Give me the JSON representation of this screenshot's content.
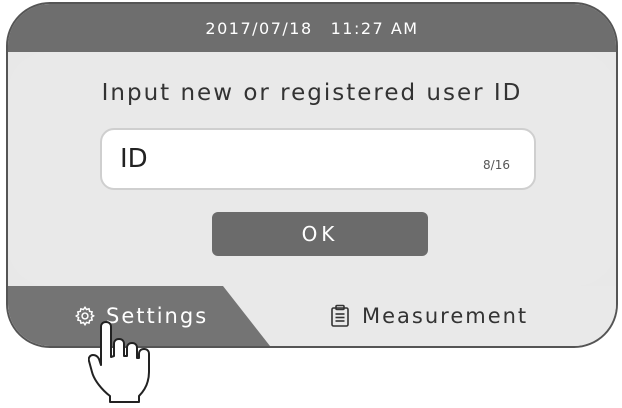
{
  "header": {
    "date": "2017/07/18",
    "time": "11:27 AM"
  },
  "prompt": "Input new or registered user ID",
  "id_field": {
    "value": "ID",
    "counter": "8/16"
  },
  "ok_label": "OK",
  "tabs": {
    "settings": "Settings",
    "measurement": "Measurement"
  },
  "colors": {
    "bar": "#6e6e6e",
    "panel": "#e9e9e9",
    "button": "#6b6b6b"
  },
  "icons": {
    "settings": "gear-icon",
    "measurement": "clipboard-icon",
    "pointer": "hand-pointer-icon"
  }
}
